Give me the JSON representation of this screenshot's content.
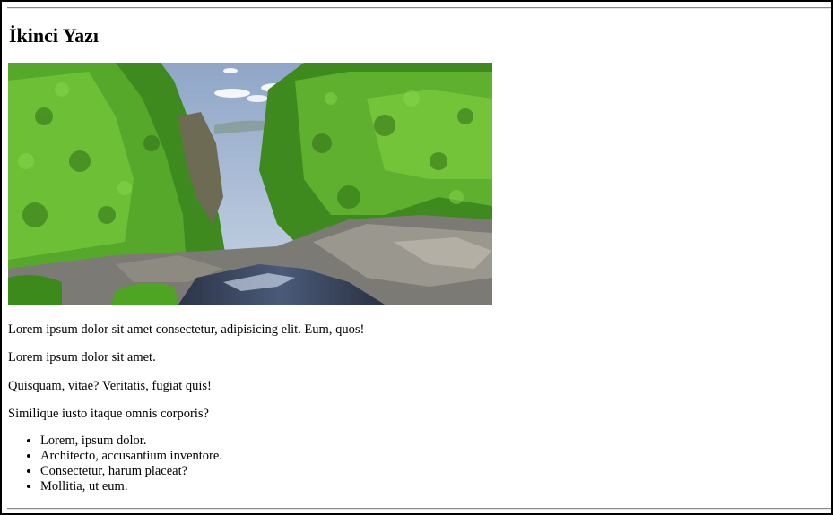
{
  "post": {
    "title": "İkinci Yazı",
    "paragraphs": [
      "Lorem ipsum dolor sit amet consectetur, adipisicing elit. Eum, quos!",
      "Lorem ipsum dolor sit amet.",
      "Quisquam, vitae? Veritatis, fugiat quis!",
      "Similique iusto itaque omnis corporis?"
    ],
    "list_items": [
      "Lorem, ipsum dolor.",
      "Architecto, accusantium inventore.",
      "Consectetur, harum placeat?",
      "Mollitia, ut eum."
    ]
  }
}
